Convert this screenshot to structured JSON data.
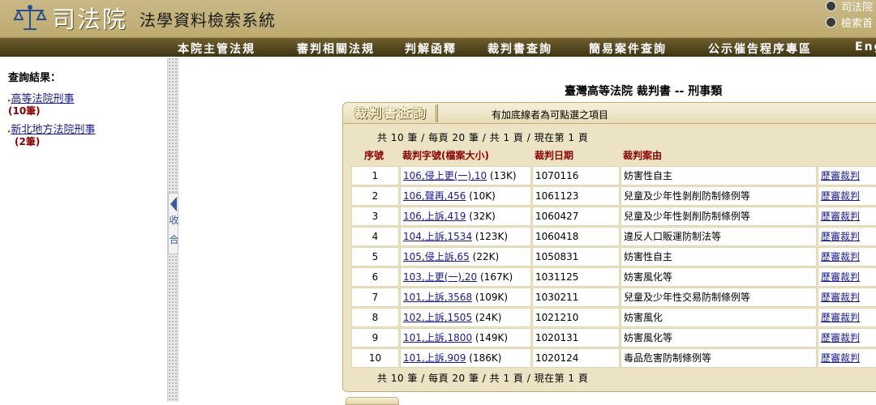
{
  "header": {
    "logo_text": "司法院",
    "system_title": "法學資料檢索系統",
    "top_links": [
      "司法院",
      "檢索首"
    ]
  },
  "menu": [
    "本院主管法規",
    "審判相關法規",
    "判解函釋",
    "裁判書查詢",
    "簡易案件查詢",
    "公示催告程序專區",
    "Eng"
  ],
  "sidebar": {
    "title": "查詢結果：",
    "courts": [
      {
        "label": "高等法院刑事",
        "count": "(10筆)"
      },
      {
        "label": "新北地方法院刑事",
        "count": "(2筆)"
      }
    ],
    "collapse_label": [
      "收",
      "合"
    ]
  },
  "main": {
    "title": "臺灣高等法院 裁判書 -- 刑事類",
    "tab_label": "裁判書查詢",
    "note": "有加底線者為可點選之項目",
    "pager_top": "共 10 筆 / 每頁 20 筆 / 共 1 頁 / 現在第 1 頁",
    "pager_bottom": "共 10 筆 / 每頁 20 筆 / 共 1 頁 / 現在第 1 頁",
    "columns": [
      "序號",
      "裁判字號(檔案大小)",
      "裁判日期",
      "裁判案由"
    ],
    "rows": [
      {
        "no": "1",
        "case": "106,侵上更(一),10",
        "size": "(13K)",
        "date": "1070116",
        "reason": "妨害性自主",
        "history": "歷審裁判"
      },
      {
        "no": "2",
        "case": "106,聲再,456",
        "size": "(10K)",
        "date": "1061123",
        "reason": "兒童及少年性剝削防制條例等",
        "history": "歷審裁判"
      },
      {
        "no": "3",
        "case": "106,上訴,419",
        "size": "(32K)",
        "date": "1060427",
        "reason": "兒童及少年性剝削防制條例等",
        "history": "歷審裁判"
      },
      {
        "no": "4",
        "case": "104,上訴,1534",
        "size": "(123K)",
        "date": "1060418",
        "reason": "違反人口販運防制法等",
        "history": "歷審裁判"
      },
      {
        "no": "5",
        "case": "105,侵上訴,65",
        "size": "(22K)",
        "date": "1050831",
        "reason": "妨害性自主",
        "history": "歷審裁判"
      },
      {
        "no": "6",
        "case": "103,上更(一),20",
        "size": "(167K)",
        "date": "1031125",
        "reason": "妨害風化等",
        "history": "歷審裁判"
      },
      {
        "no": "7",
        "case": "101,上訴,3568",
        "size": "(109K)",
        "date": "1030211",
        "reason": "兒童及少年性交易防制條例等",
        "history": "歷審裁判"
      },
      {
        "no": "8",
        "case": "102,上訴,1505",
        "size": "(24K)",
        "date": "1021210",
        "reason": "妨害風化",
        "history": "歷審裁判"
      },
      {
        "no": "9",
        "case": "101,上訴,1800",
        "size": "(149K)",
        "date": "1020131",
        "reason": "妨害風化等",
        "history": "歷審裁判"
      },
      {
        "no": "10",
        "case": "101,上訴,909",
        "size": "(186K)",
        "date": "1020124",
        "reason": "毒品危害防制條例等",
        "history": "歷審裁判"
      }
    ]
  },
  "colors": {
    "header_bg": "#b7a363",
    "menubar_bg": "#4a3d18",
    "panel_bg": "#ece3c4",
    "header_text": "#8b0000",
    "link": "#1a1a8c"
  }
}
